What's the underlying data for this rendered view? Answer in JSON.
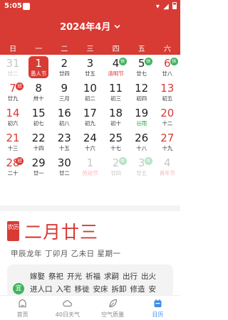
{
  "status_bar": {
    "time": "5:05"
  },
  "header": {
    "month_title": "2024年4月",
    "chevron": "⌄"
  },
  "weekdays": [
    "日",
    "一",
    "二",
    "三",
    "四",
    "五",
    "六"
  ],
  "calendar": {
    "weeks": [
      [
        {
          "day": "31",
          "sub": "廿二",
          "kind": "other weekend"
        },
        {
          "day": "1",
          "sub": "愚人节",
          "kind": "selected"
        },
        {
          "day": "2",
          "sub": "廿四",
          "kind": "workday"
        },
        {
          "day": "3",
          "sub": "廿五",
          "kind": "workday"
        },
        {
          "day": "4",
          "sub": "清明节",
          "kind": "workday festival",
          "badge": "休",
          "badge_kind": "rest"
        },
        {
          "day": "5",
          "sub": "廿七",
          "kind": "workday",
          "badge": "休",
          "badge_kind": "rest"
        },
        {
          "day": "6",
          "sub": "廿八",
          "kind": "weekend",
          "badge": "休",
          "badge_kind": "rest"
        }
      ],
      [
        {
          "day": "7",
          "sub": "廿九",
          "kind": "weekend",
          "badge": "班",
          "badge_kind": "work"
        },
        {
          "day": "8",
          "sub": "卅十",
          "kind": "workday"
        },
        {
          "day": "9",
          "sub": "三月",
          "kind": "workday"
        },
        {
          "day": "10",
          "sub": "初二",
          "kind": "workday"
        },
        {
          "day": "11",
          "sub": "初三",
          "kind": "workday"
        },
        {
          "day": "12",
          "sub": "初四",
          "kind": "workday"
        },
        {
          "day": "13",
          "sub": "初五",
          "kind": "weekend"
        }
      ],
      [
        {
          "day": "14",
          "sub": "初六",
          "kind": "weekend"
        },
        {
          "day": "15",
          "sub": "初七",
          "kind": "workday"
        },
        {
          "day": "16",
          "sub": "初八",
          "kind": "workday"
        },
        {
          "day": "17",
          "sub": "初九",
          "kind": "workday"
        },
        {
          "day": "18",
          "sub": "初十",
          "kind": "workday"
        },
        {
          "day": "19",
          "sub": "谷雨",
          "kind": "workday term"
        },
        {
          "day": "20",
          "sub": "十二",
          "kind": "weekend"
        }
      ],
      [
        {
          "day": "21",
          "sub": "十三",
          "kind": "weekend"
        },
        {
          "day": "22",
          "sub": "十四",
          "kind": "workday"
        },
        {
          "day": "23",
          "sub": "十五",
          "kind": "workday"
        },
        {
          "day": "24",
          "sub": "十六",
          "kind": "workday"
        },
        {
          "day": "25",
          "sub": "十七",
          "kind": "workday"
        },
        {
          "day": "26",
          "sub": "十八",
          "kind": "workday"
        },
        {
          "day": "27",
          "sub": "十九",
          "kind": "weekend"
        }
      ],
      [
        {
          "day": "28",
          "sub": "二十",
          "kind": "weekend",
          "badge": "班",
          "badge_kind": "work"
        },
        {
          "day": "29",
          "sub": "廿一",
          "kind": "workday"
        },
        {
          "day": "30",
          "sub": "廿二",
          "kind": "workday"
        },
        {
          "day": "1",
          "sub": "劳动节",
          "kind": "other festival"
        },
        {
          "day": "2",
          "sub": "廿四",
          "kind": "other",
          "badge": "休",
          "badge_kind": "rest faded"
        },
        {
          "day": "3",
          "sub": "廿五",
          "kind": "other",
          "badge": "休",
          "badge_kind": "rest faded"
        },
        {
          "day": "4",
          "sub": "青年节",
          "kind": "other festival weekend"
        }
      ]
    ]
  },
  "lunar": {
    "tag": "农历",
    "date": "二月廿三",
    "ganzhi": "甲辰龙年 丁卯月 乙未日 星期一"
  },
  "yi": {
    "icon": "宜",
    "items": [
      "嫁娶",
      "祭祀",
      "开光",
      "祈福",
      "求嗣",
      "出行",
      "出火",
      "进人口",
      "入宅",
      "移徙",
      "安床",
      "拆卸",
      "修造",
      "安"
    ]
  },
  "bottom_nav": [
    {
      "label": "首页",
      "icon": "home-icon",
      "active": false
    },
    {
      "label": "40日天气",
      "icon": "cloud-icon",
      "active": false
    },
    {
      "label": "空气质量",
      "icon": "leaf-icon",
      "active": false
    },
    {
      "label": "日历",
      "icon": "calendar-icon",
      "active": true
    }
  ],
  "colors": {
    "primary": "#d83a34",
    "rest_badge": "#3fb55b",
    "active_nav": "#3e8de8"
  }
}
